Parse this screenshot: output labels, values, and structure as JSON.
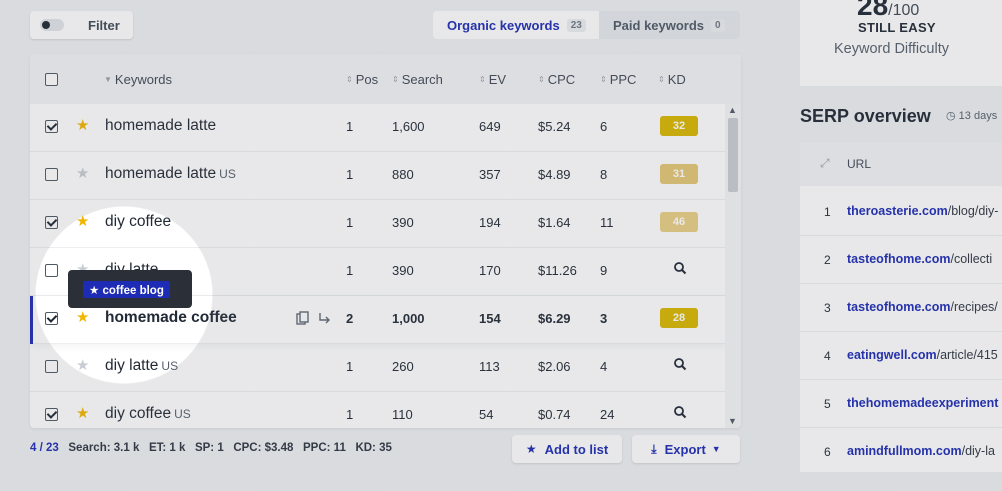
{
  "toolbar": {
    "filter_label": "Filter",
    "tabs": [
      {
        "label": "Organic keywords",
        "count": "23"
      },
      {
        "label": "Paid keywords",
        "count": "0"
      }
    ]
  },
  "table": {
    "columns": {
      "keywords": "Keywords",
      "pos": "Pos",
      "search": "Search",
      "ev": "EV",
      "cpc": "CPC",
      "ppc": "PPC",
      "kd": "KD"
    },
    "rows": [
      {
        "keyword": "homemade latte",
        "loc": "",
        "starred": true,
        "checked": true,
        "pos": "1",
        "search": "1,600",
        "ev": "649",
        "cpc": "$5.24",
        "ppc": "6",
        "kd": "32",
        "kd_color": "#d8b600"
      },
      {
        "keyword": "homemade latte",
        "loc": "US",
        "starred": false,
        "checked": false,
        "pos": "1",
        "search": "880",
        "ev": "357",
        "cpc": "$4.89",
        "ppc": "8",
        "kd": "31",
        "kd_color": "#e4c774"
      },
      {
        "keyword": "diy coffee",
        "loc": "",
        "starred": true,
        "checked": true,
        "pos": "1",
        "search": "390",
        "ev": "194",
        "cpc": "$1.64",
        "ppc": "11",
        "kd": "46",
        "kd_color": "#e8cf85"
      },
      {
        "keyword": "diy latte",
        "loc": "",
        "starred": false,
        "checked": false,
        "pos": "1",
        "search": "390",
        "ev": "170",
        "cpc": "$11.26",
        "ppc": "9",
        "kd": "",
        "kd_color": ""
      },
      {
        "keyword": "homemade coffee",
        "loc": "",
        "starred": true,
        "checked": true,
        "pos": "2",
        "search": "1,000",
        "ev": "154",
        "cpc": "$6.29",
        "ppc": "3",
        "kd": "28",
        "kd_color": "#d8b600"
      },
      {
        "keyword": "diy latte",
        "loc": "US",
        "starred": false,
        "checked": false,
        "pos": "1",
        "search": "260",
        "ev": "113",
        "cpc": "$2.06",
        "ppc": "4",
        "kd": "",
        "kd_color": ""
      },
      {
        "keyword": "diy coffee",
        "loc": "US",
        "starred": true,
        "checked": true,
        "pos": "1",
        "search": "110",
        "ev": "54",
        "cpc": "$0.74",
        "ppc": "24",
        "kd": "",
        "kd_color": ""
      }
    ]
  },
  "tooltip": {
    "tag_label": "★ coffee blog"
  },
  "footer": {
    "count": "4 / 23",
    "search": "Search: 3.1 k",
    "et": "ET: 1 k",
    "sp": "SP: 1",
    "cpc": "CPC: $3.48",
    "ppc": "PPC: 11",
    "kd": "KD: 35",
    "add_to_list": "Add to list",
    "export": "Export"
  },
  "difficulty": {
    "score": "28",
    "max": "/100",
    "word": "STILL EASY",
    "label": "Keyword Difficulty"
  },
  "serp": {
    "title": "SERP overview",
    "time": "13 days",
    "url_header": "URL",
    "rows": [
      {
        "n": "1",
        "domain": "theroasterie.com",
        "path": "/blog/diy-"
      },
      {
        "n": "2",
        "domain": "tasteofhome.com",
        "path": "/collecti"
      },
      {
        "n": "3",
        "domain": "tasteofhome.com",
        "path": "/recipes/"
      },
      {
        "n": "4",
        "domain": "eatingwell.com",
        "path": "/article/415"
      },
      {
        "n": "5",
        "domain": "thehomemadeexperiment",
        "path": ""
      },
      {
        "n": "6",
        "domain": "amindfullmom.com",
        "path": "/diy-la"
      }
    ]
  }
}
